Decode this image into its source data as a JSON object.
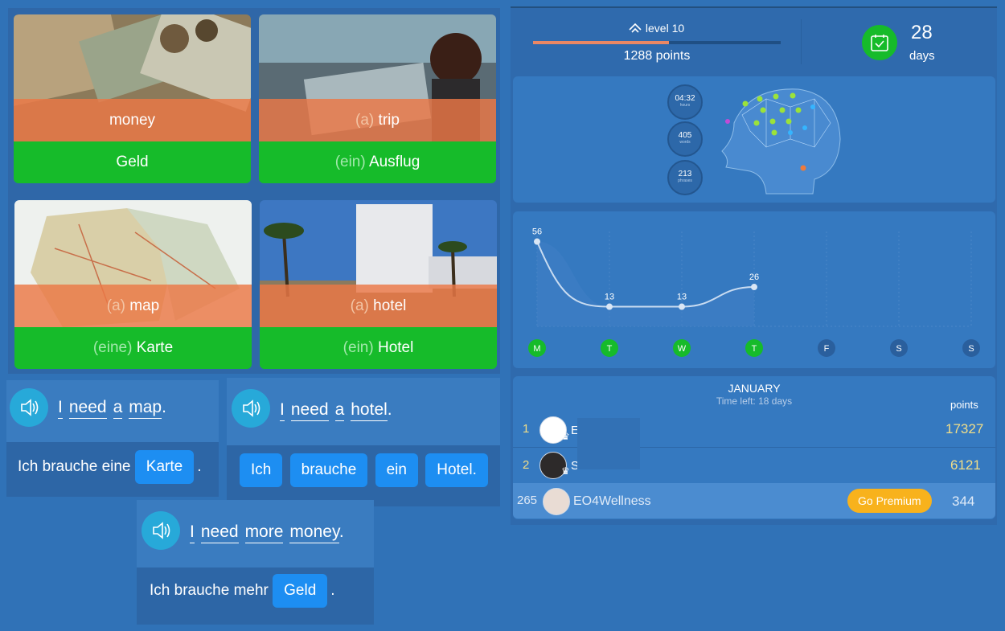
{
  "cards": [
    {
      "art": "",
      "en": "money",
      "de_art": "",
      "de": "Geld",
      "image": "money-photo"
    },
    {
      "art": "(a)",
      "en": "trip",
      "de_art": "(ein)",
      "de": "Ausflug",
      "image": "car-trip-photo"
    },
    {
      "art": "(a)",
      "en": "map",
      "de_art": "(eine)",
      "de": "Karte",
      "image": "map-photo"
    },
    {
      "art": "(a)",
      "en": "hotel",
      "de_art": "(ein)",
      "de": "Hotel",
      "image": "hotel-photo"
    }
  ],
  "sentences": [
    {
      "words": [
        "I",
        "need",
        "a",
        "map"
      ],
      "end": ".",
      "answer_prefix": "Ich brauche eine",
      "answer_chip": "Karte",
      "answer_end": "."
    },
    {
      "words": [
        "I",
        "need",
        "a",
        "hotel"
      ],
      "end": ".",
      "chips": [
        "Ich",
        "brauche",
        "ein",
        "Hotel."
      ]
    },
    {
      "words": [
        "I",
        "need",
        "more",
        "money"
      ],
      "end": ".",
      "answer_prefix": "Ich brauche mehr",
      "answer_chip": "Geld",
      "answer_end": "."
    }
  ],
  "progress": {
    "level_label": "level 10",
    "points_label": "1288 points",
    "level_progress_fraction": 0.55,
    "streak_value": "28",
    "streak_unit": "days"
  },
  "brain_stats": [
    {
      "value": "04:32",
      "label": "hours"
    },
    {
      "value": "405",
      "label": "words"
    },
    {
      "value": "213",
      "label": "phrases"
    }
  ],
  "chart_data": {
    "type": "line",
    "categories": [
      "M",
      "T",
      "W",
      "T",
      "F",
      "S",
      "S"
    ],
    "values": [
      56,
      13,
      13,
      26,
      null,
      null,
      null
    ],
    "ylim": [
      0,
      60
    ],
    "grid": true,
    "active_days": [
      true,
      true,
      true,
      true,
      false,
      false,
      false
    ]
  },
  "leaderboard": {
    "month": "JANUARY",
    "time_left": "Time left: 18 days",
    "points_header": "points",
    "rows": [
      {
        "rank": "1",
        "name": "E",
        "points": "17327"
      },
      {
        "rank": "2",
        "name": "S",
        "points": "6121"
      }
    ],
    "me": {
      "rank": "265",
      "name": "EO4Wellness",
      "points": "344",
      "cta": "Go Premium"
    }
  },
  "colors": {
    "green": "#16bb2a",
    "orange": "#eb7846",
    "blue_chip": "#1d8ef2",
    "premium": "#f8b21c"
  }
}
